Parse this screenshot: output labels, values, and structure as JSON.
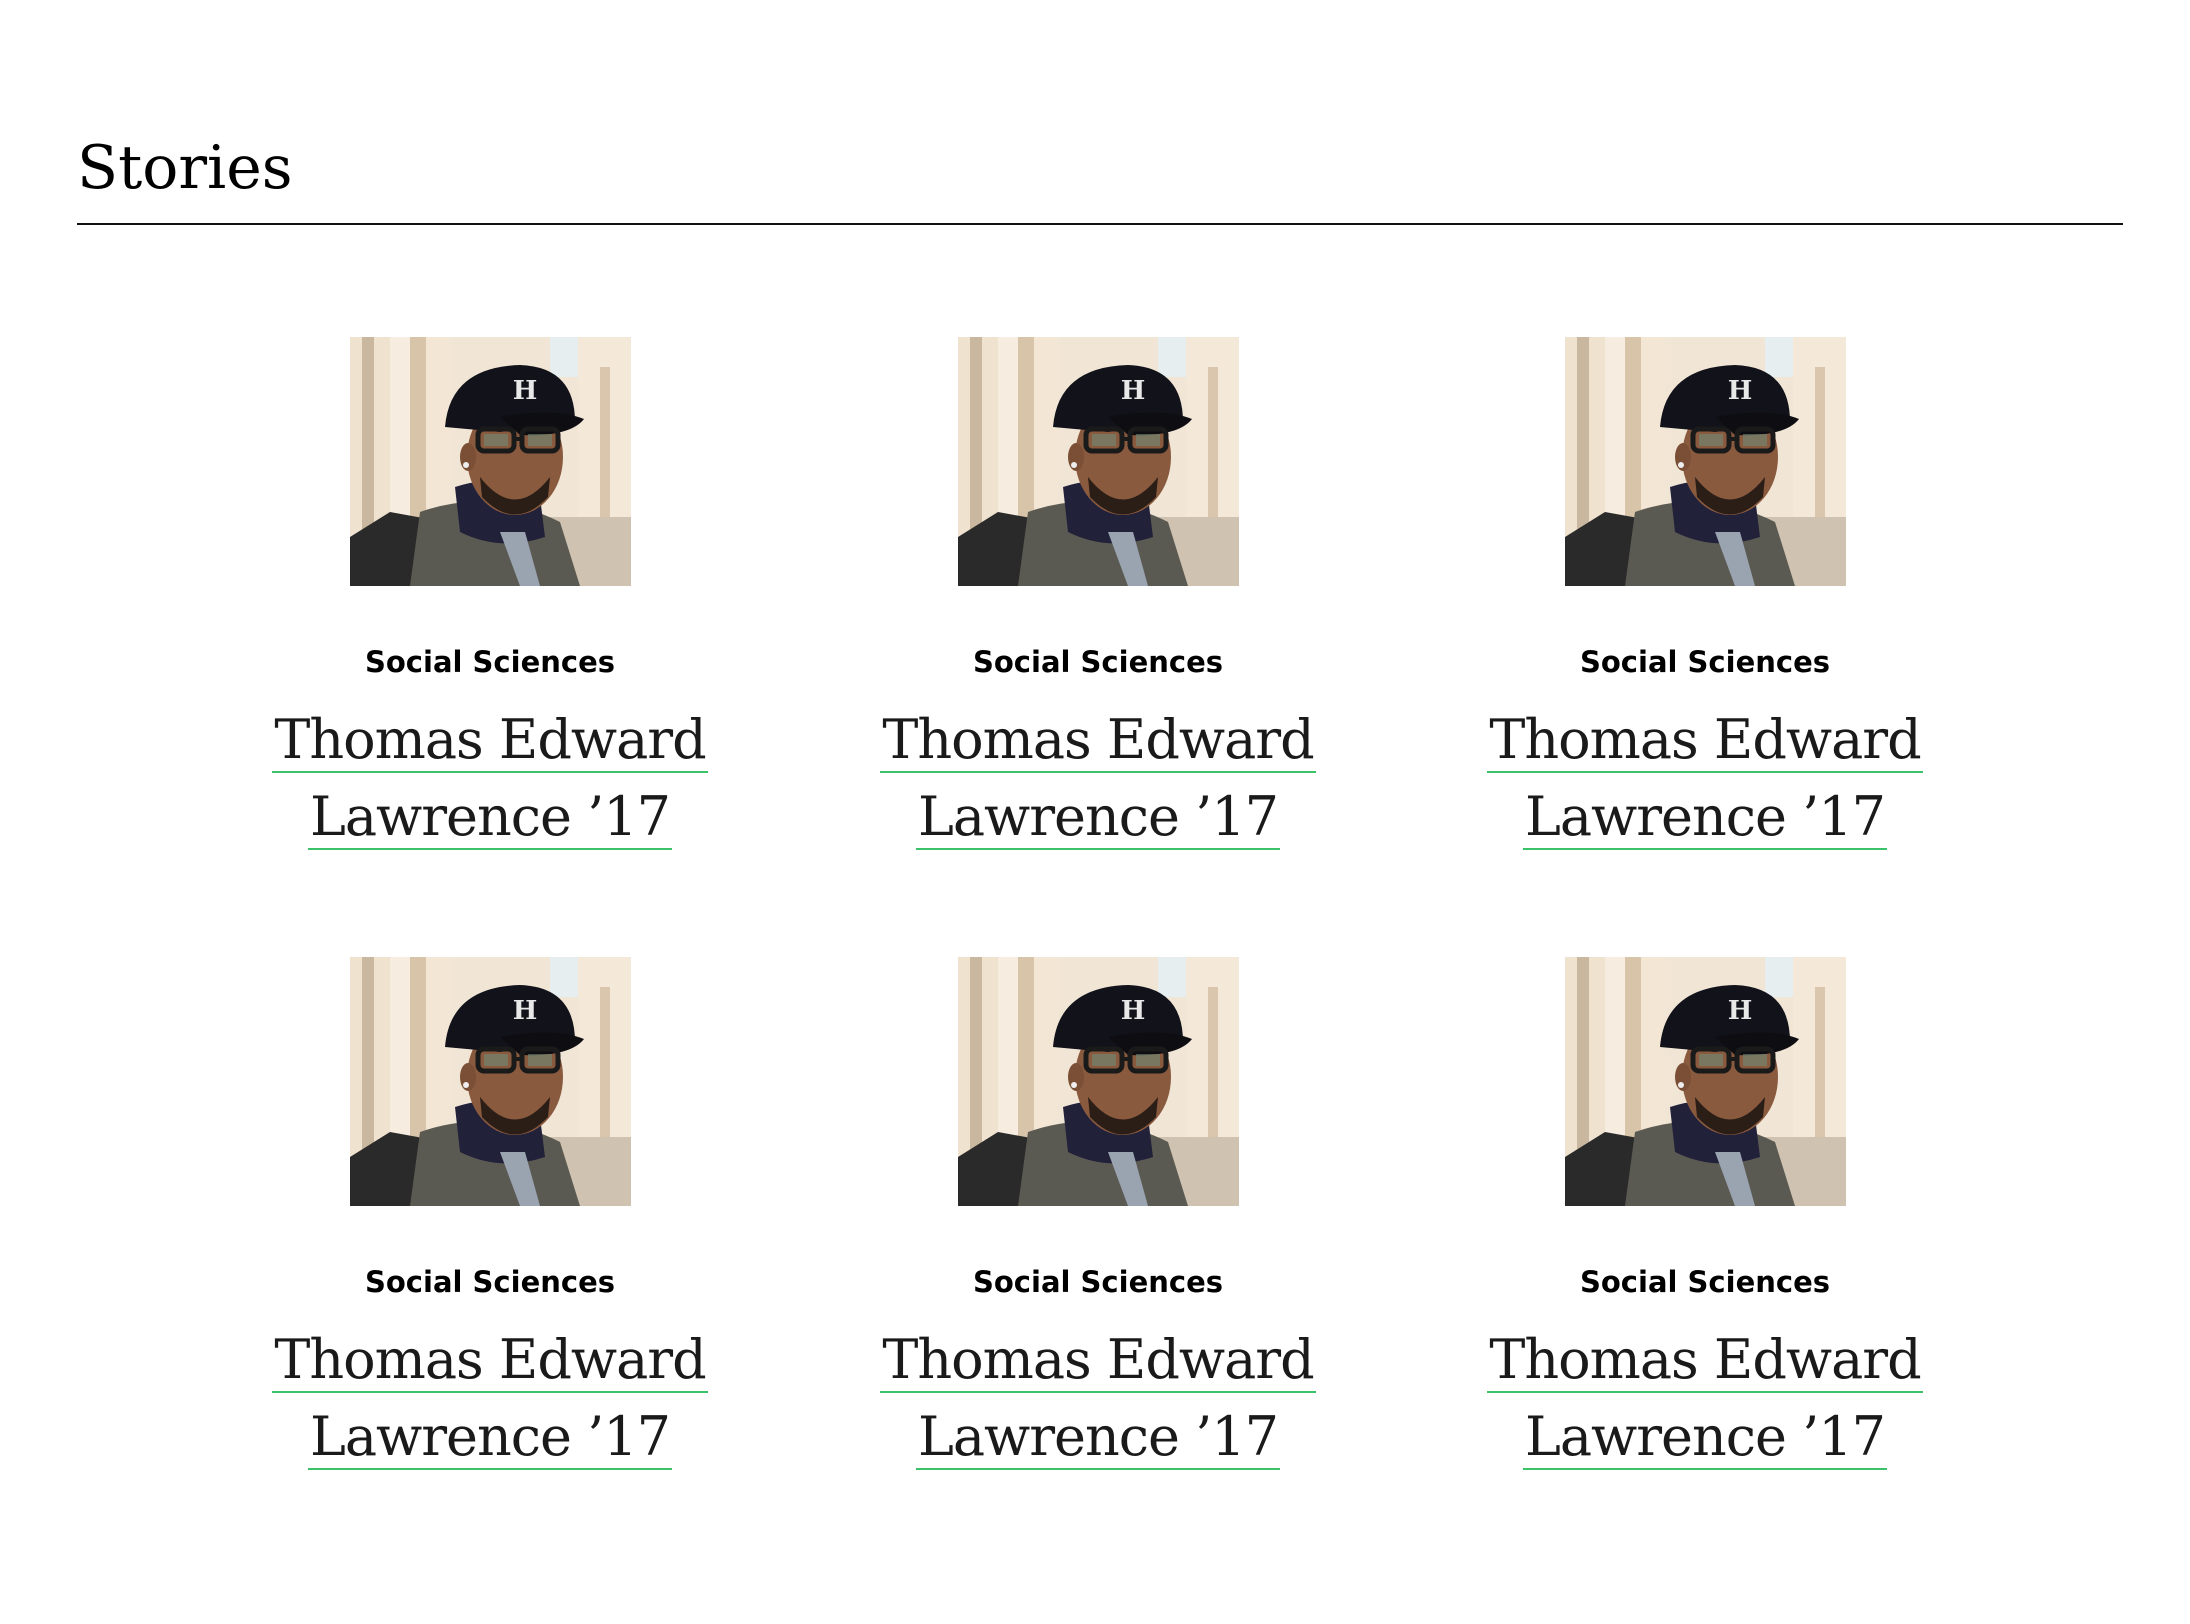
{
  "section": {
    "title": "Stories"
  },
  "cards": [
    {
      "category": "Social Sciences",
      "name_line1": "Thomas Edward",
      "name_line2": "Lawrence ’17"
    },
    {
      "category": "Social Sciences",
      "name_line1": "Thomas Edward",
      "name_line2": "Lawrence ’17"
    },
    {
      "category": "Social Sciences",
      "name_line1": "Thomas Edward",
      "name_line2": "Lawrence ’17"
    },
    {
      "category": "Social Sciences",
      "name_line1": "Thomas Edward",
      "name_line2": "Lawrence ’17"
    },
    {
      "category": "Social Sciences",
      "name_line1": "Thomas Edward",
      "name_line2": "Lawrence ’17"
    },
    {
      "category": "Social Sciences",
      "name_line1": "Thomas Edward",
      "name_line2": "Lawrence ’17"
    }
  ],
  "colors": {
    "link_underline": "#3cc36a",
    "rule": "#111111"
  },
  "icons": {
    "photo": "portrait-photo"
  }
}
